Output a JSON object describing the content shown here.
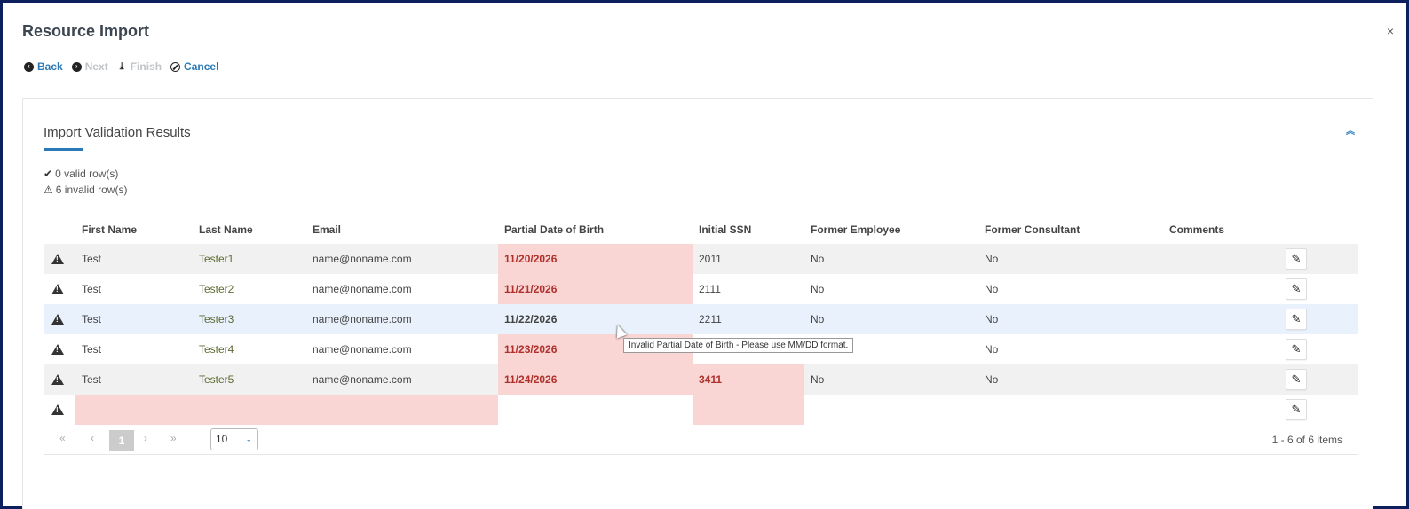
{
  "modal": {
    "title": "Resource Import",
    "close_symbol": "×"
  },
  "toolbar": {
    "back_label": "Back",
    "next_label": "Next",
    "finish_label": "Finish",
    "cancel_label": "Cancel"
  },
  "panel": {
    "title": "Import Validation Results",
    "valid_rows": "0 valid row(s)",
    "invalid_rows": "6 invalid row(s)"
  },
  "grid": {
    "columns": [
      "First Name",
      "Last Name",
      "Email",
      "Partial Date of Birth",
      "Initial SSN",
      "Former Employee",
      "Former Consultant",
      "Comments"
    ],
    "rows": [
      {
        "first": "Test",
        "last": "Tester1",
        "email": "name@noname.com",
        "dob": "11/20/2026",
        "ssn": "2011",
        "former_employee": "No",
        "former_consultant": "No",
        "comments": ""
      },
      {
        "first": "Test",
        "last": "Tester2",
        "email": "name@noname.com",
        "dob": "11/21/2026",
        "ssn": "2111",
        "former_employee": "No",
        "former_consultant": "No",
        "comments": ""
      },
      {
        "first": "Test",
        "last": "Tester3",
        "email": "name@noname.com",
        "dob": "11/22/2026",
        "ssn": "2211",
        "former_employee": "No",
        "former_consultant": "No",
        "comments": ""
      },
      {
        "first": "Test",
        "last": "Tester4",
        "email": "name@noname.com",
        "dob": "11/23/2026",
        "ssn": "",
        "former_employee": "",
        "former_consultant": "No",
        "comments": ""
      },
      {
        "first": "Test",
        "last": "Tester5",
        "email": "name@noname.com",
        "dob": "11/24/2026",
        "ssn": "3411",
        "former_employee": "No",
        "former_consultant": "No",
        "comments": ""
      },
      {
        "first": "",
        "last": "",
        "email": "",
        "dob": "",
        "ssn": "",
        "former_employee": "",
        "former_consultant": "",
        "comments": ""
      }
    ]
  },
  "pager": {
    "first": "«",
    "prev": "‹",
    "current_page": "1",
    "next": "›",
    "last": "»",
    "page_size": "10",
    "info": "1 - 6 of 6 items"
  },
  "tooltip": {
    "text": "Invalid Partial Date of Birth - Please use MM/DD format."
  },
  "colors": {
    "accent": "#2a7ab8",
    "error_bg": "#f9d6d4",
    "error_text": "#b0302c",
    "backdrop": "#0d1f5c"
  }
}
